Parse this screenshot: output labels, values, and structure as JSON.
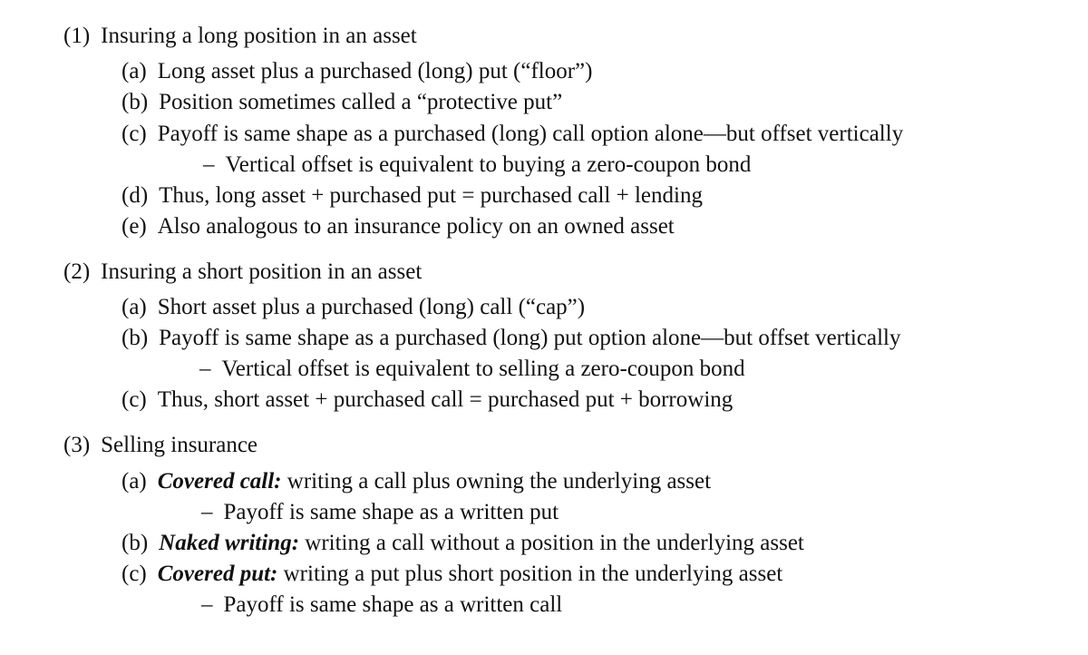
{
  "sections": [
    {
      "number": "(1)",
      "title": "Insuring a long position in an asset",
      "items": [
        {
          "label": "(a)",
          "text": "Long asset plus a purchased (long) put (“floor”)"
        },
        {
          "label": "(b)",
          "text": "Position sometimes called a “protective put”"
        },
        {
          "label": "(c)",
          "text": "Payoff is same shape as a purchased (long) call option alone—but offset vertically",
          "sub": {
            "dash": "–",
            "text": "Vertical offset is equivalent to buying a zero-coupon bond"
          }
        },
        {
          "label": "(d)",
          "text": "Thus, long asset + purchased put = purchased call + lending"
        },
        {
          "label": "(e)",
          "text": "Also analogous to an insurance policy on an owned asset"
        }
      ]
    },
    {
      "number": "(2)",
      "title": "Insuring a short position in an asset",
      "items": [
        {
          "label": "(a)",
          "text": "Short asset plus a purchased (long) call (“cap”)"
        },
        {
          "label": "(b)",
          "text": "Payoff is same shape as a purchased (long) put option alone—but offset vertically",
          "sub": {
            "dash": "–",
            "text": "Vertical offset is equivalent to selling a zero-coupon bond"
          }
        },
        {
          "label": "(c)",
          "text": "Thus, short asset + purchased call = purchased put + borrowing"
        }
      ]
    },
    {
      "number": "(3)",
      "title": "Selling insurance",
      "items": [
        {
          "label": "(a)",
          "term": "Covered call:",
          "text": "writing a call plus owning the underlying asset",
          "sub": {
            "dash": "–",
            "text": "Payoff is same shape as a written put"
          }
        },
        {
          "label": "(b)",
          "term": "Naked writing:",
          "text": "writing a call without a position in the underlying asset"
        },
        {
          "label": "(c)",
          "term": "Covered put:",
          "text": "writing a put plus short position in the underlying asset",
          "sub": {
            "dash": "–",
            "text": "Payoff is same shape as a written call"
          }
        }
      ]
    }
  ]
}
